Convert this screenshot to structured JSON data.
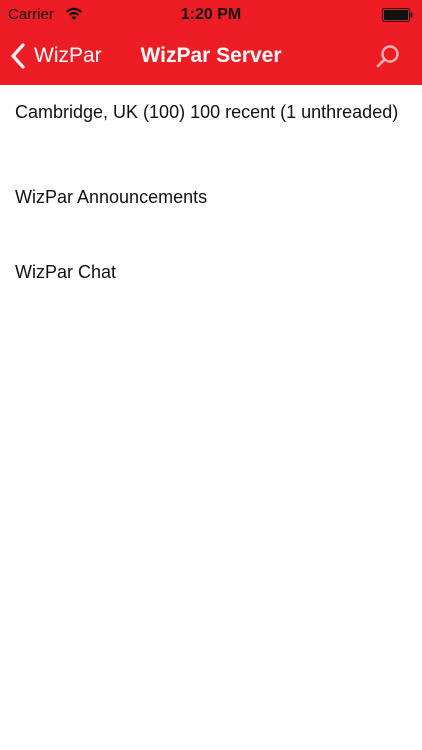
{
  "status_bar": {
    "carrier": "Carrier",
    "time": "1:20 PM"
  },
  "nav": {
    "back_label": "WizPar",
    "title": "WizPar Server",
    "search_icon": "search-icon",
    "back_icon": "chevron-left-icon"
  },
  "list": {
    "items": [
      {
        "label": "Cambridge, UK (100) 100 recent (1 unthreaded)"
      },
      {
        "label": "WizPar Announcements"
      },
      {
        "label": "WizPar Chat"
      }
    ]
  },
  "colors": {
    "accent": "#ee1c24",
    "text": "#111111",
    "nav_text": "#ffffff"
  }
}
